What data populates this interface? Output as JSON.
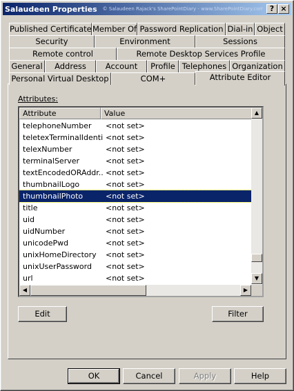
{
  "window": {
    "title": "Salaudeen Properties",
    "watermark": "© Salaudeen Rajack's SharePointDiary - www.SharePointDiary.com",
    "help_btn": "?",
    "close_btn": "×"
  },
  "tabs": {
    "row1": [
      "Published Certificates",
      "Member Of",
      "Password Replication",
      "Dial-in",
      "Object"
    ],
    "row2": [
      "Security",
      "Environment",
      "Sessions"
    ],
    "row3": [
      "Remote control",
      "Remote Desktop Services Profile"
    ],
    "row4": [
      "General",
      "Address",
      "Account",
      "Profile",
      "Telephones",
      "Organization"
    ],
    "row5": [
      "Personal Virtual Desktop",
      "COM+",
      "Attribute Editor"
    ],
    "active": "Attribute Editor"
  },
  "attributes_label": "Attributes:",
  "table": {
    "col_attribute": "Attribute",
    "col_value": "Value",
    "rows": [
      {
        "attr": "telephoneNumber",
        "value": "<not set>"
      },
      {
        "attr": "teletexTerminalIdentifier",
        "value": "<not set>"
      },
      {
        "attr": "telexNumber",
        "value": "<not set>"
      },
      {
        "attr": "terminalServer",
        "value": "<not set>"
      },
      {
        "attr": "textEncodedORAddr...",
        "value": "<not set>"
      },
      {
        "attr": "thumbnailLogo",
        "value": "<not set>"
      },
      {
        "attr": "thumbnailPhoto",
        "value": "<not set>"
      },
      {
        "attr": "title",
        "value": "<not set>"
      },
      {
        "attr": "uid",
        "value": "<not set>"
      },
      {
        "attr": "uidNumber",
        "value": "<not set>"
      },
      {
        "attr": "unicodePwd",
        "value": "<not set>"
      },
      {
        "attr": "unixHomeDirectory",
        "value": "<not set>"
      },
      {
        "attr": "unixUserPassword",
        "value": "<not set>"
      },
      {
        "attr": "url",
        "value": "<not set>"
      }
    ],
    "selected": "thumbnailPhoto"
  },
  "buttons": {
    "edit": "Edit",
    "filter": "Filter",
    "ok": "OK",
    "cancel": "Cancel",
    "apply": "Apply",
    "help": "Help"
  },
  "colors": {
    "selection": "#0a246a",
    "face": "#d4d0c8"
  }
}
